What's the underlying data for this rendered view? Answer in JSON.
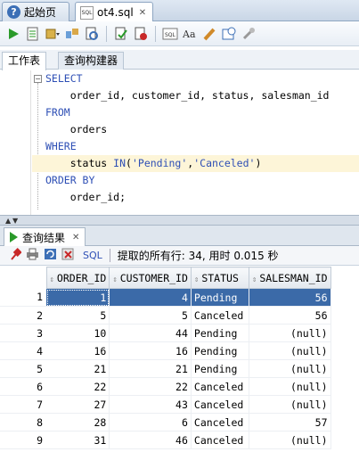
{
  "tabs": [
    {
      "label": "起始页",
      "icon": "help-icon"
    },
    {
      "label": "ot4.sql",
      "icon": "sql-file-icon"
    }
  ],
  "toolbar": {
    "buttons": [
      "run-statement-icon",
      "run-script-icon",
      "commit-dropdown-icon",
      "explain-plan-icon",
      "autotrace-icon",
      "commit-icon",
      "rollback-icon",
      "sql-tuning-icon",
      "uppercase-icon",
      "clear-icon",
      "history-icon",
      "tools-icon"
    ]
  },
  "subtabs": {
    "worksheet": "工作表",
    "query_builder": "查询构建器"
  },
  "editor": {
    "lines": [
      {
        "kw": "SELECT",
        "text": ""
      },
      {
        "kw": "",
        "text": "    order_id, customer_id, status, salesman_id"
      },
      {
        "kw": "FROM",
        "text": ""
      },
      {
        "kw": "",
        "text": "    orders"
      },
      {
        "kw": "WHERE",
        "text": ""
      },
      {
        "kw": "",
        "text": "    status IN('Pending','Canceled')"
      },
      {
        "kw": "ORDER BY",
        "text": ""
      },
      {
        "kw": "",
        "text": "    order_id;"
      }
    ]
  },
  "results": {
    "tab_label": "查询结果",
    "sql_link": "SQL",
    "status_text": "提取的所有行: 34, 用时 0.015 秒",
    "columns": [
      "ORDER_ID",
      "CUSTOMER_ID",
      "STATUS",
      "SALESMAN_ID"
    ],
    "rows": [
      {
        "n": "1",
        "order_id": "1",
        "customer_id": "4",
        "status": "Pending",
        "salesman_id": "56"
      },
      {
        "n": "2",
        "order_id": "5",
        "customer_id": "5",
        "status": "Canceled",
        "salesman_id": "56"
      },
      {
        "n": "3",
        "order_id": "10",
        "customer_id": "44",
        "status": "Pending",
        "salesman_id": "(null)"
      },
      {
        "n": "4",
        "order_id": "16",
        "customer_id": "16",
        "status": "Pending",
        "salesman_id": "(null)"
      },
      {
        "n": "5",
        "order_id": "21",
        "customer_id": "21",
        "status": "Pending",
        "salesman_id": "(null)"
      },
      {
        "n": "6",
        "order_id": "22",
        "customer_id": "22",
        "status": "Canceled",
        "salesman_id": "(null)"
      },
      {
        "n": "7",
        "order_id": "27",
        "customer_id": "43",
        "status": "Canceled",
        "salesman_id": "(null)"
      },
      {
        "n": "8",
        "order_id": "28",
        "customer_id": "6",
        "status": "Canceled",
        "salesman_id": "57"
      },
      {
        "n": "9",
        "order_id": "31",
        "customer_id": "46",
        "status": "Canceled",
        "salesman_id": "(null)"
      }
    ]
  }
}
